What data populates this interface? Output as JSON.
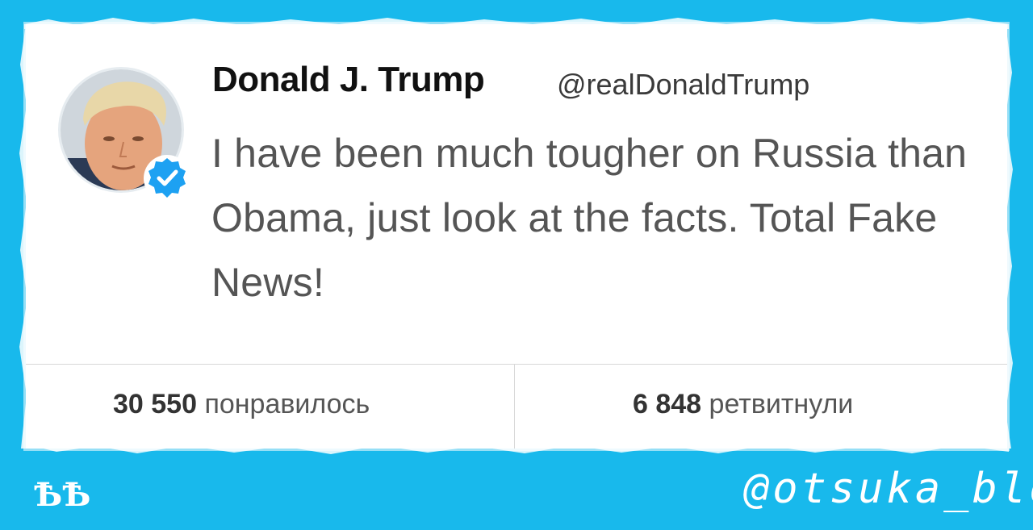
{
  "tweet": {
    "name": "Donald J. Trump",
    "handle": "@realDonaldTrump",
    "text": "I have been much tougher on Russia than Obama, just look at the facts. Total Fake News!",
    "avatar_icon": "profile-photo",
    "verified_icon": "verified-badge-icon"
  },
  "stats": {
    "likes_count": "30 550",
    "likes_label": "понравилось",
    "retweets_count": "6 848",
    "retweets_label": "ретвитнули"
  },
  "footer": {
    "logo_text": "ѢѢ",
    "credit": "@otsuka_bld"
  },
  "colors": {
    "background": "#18b9ec",
    "card": "#ffffff",
    "verified": "#1da1f2"
  }
}
